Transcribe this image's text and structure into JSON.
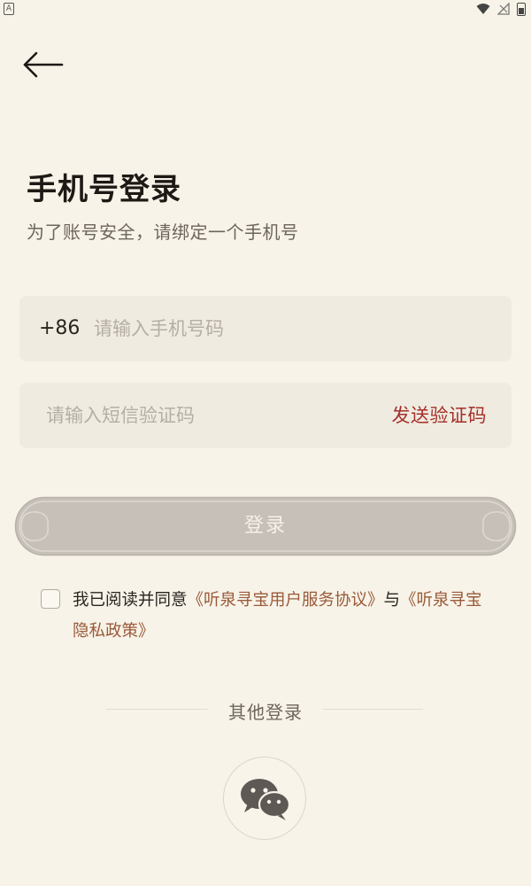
{
  "status_bar": {
    "left_icon_letter": "A"
  },
  "header": {
    "title": "手机号登录",
    "subtitle": "为了账号安全，请绑定一个手机号"
  },
  "phone_field": {
    "country_code": "+86",
    "placeholder": "请输入手机号码",
    "value": ""
  },
  "code_field": {
    "placeholder": "请输入短信验证码",
    "value": "",
    "send_label": "发送验证码"
  },
  "login": {
    "label": "登录"
  },
  "agreement": {
    "checked": false,
    "prefix": "我已阅读并同意",
    "terms_link": "《听泉寻宝用户服务协议》",
    "joiner": "与",
    "privacy_link": "《听泉寻宝隐私政策》"
  },
  "other_login": {
    "label": "其他登录"
  },
  "colors": {
    "background": "#f7f3e8",
    "field_bg": "#efebe0",
    "accent_red": "#a62f2a",
    "link_brown": "#9a5a3a",
    "login_button": "#c6c0b9"
  }
}
